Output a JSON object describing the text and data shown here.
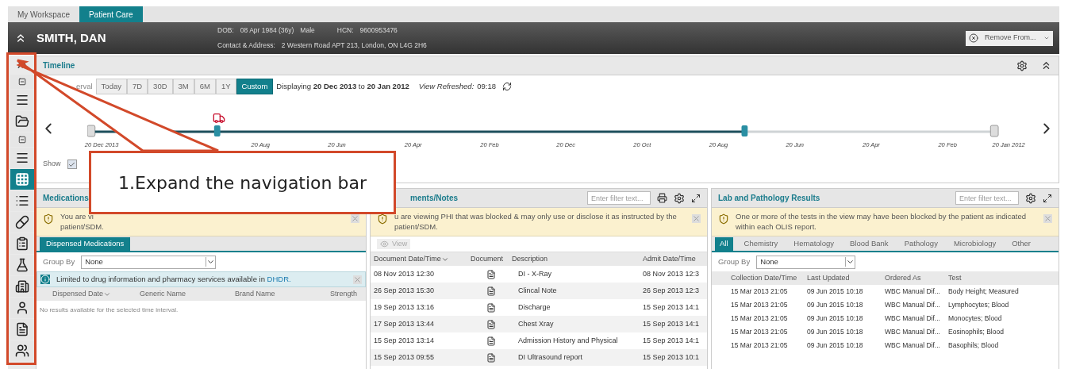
{
  "top_tabs": [
    {
      "label": "My Workspace",
      "selected": false
    },
    {
      "label": "Patient Care",
      "selected": true
    }
  ],
  "patient": {
    "name": "SMITH, DAN",
    "dob_label": "DOB:",
    "dob": "08 Apr 1984 (36y)",
    "sex": "Male",
    "hcn_label": "HCN:",
    "hcn": "9600953476",
    "address_label": "Contact & Address:",
    "address": "2 Western Road APT 213, London, ON L4G 2H6",
    "remove_button": "Remove From..."
  },
  "nav": [
    {
      "kind": "collapse",
      "selected": false
    },
    {
      "kind": "menu",
      "selected": false
    },
    {
      "kind": "folder",
      "selected": false
    },
    {
      "kind": "collapse",
      "selected": false
    },
    {
      "kind": "menu",
      "selected": false
    },
    {
      "kind": "grid",
      "selected": true
    },
    {
      "kind": "list",
      "selected": false
    },
    {
      "kind": "pills",
      "selected": false
    },
    {
      "kind": "clipboard",
      "selected": false
    },
    {
      "kind": "flask",
      "selected": false
    },
    {
      "kind": "building",
      "selected": false
    },
    {
      "kind": "person",
      "selected": false
    },
    {
      "kind": "document",
      "selected": false
    },
    {
      "kind": "group",
      "selected": false
    }
  ],
  "timeline": {
    "title": "Timeline",
    "interval_label": "erval",
    "intervals": [
      {
        "label": "Today",
        "selected": false
      },
      {
        "label": "7D",
        "selected": false
      },
      {
        "label": "30D",
        "selected": false
      },
      {
        "label": "3M",
        "selected": false
      },
      {
        "label": "6M",
        "selected": false
      },
      {
        "label": "1Y",
        "selected": false
      },
      {
        "label": "Custom",
        "selected": true
      }
    ],
    "displaying": "Displaying **20 Dec 2013** to **20 Jan 2012**",
    "refreshed_label": "View Refreshed:",
    "refreshed": "09:18",
    "ticks": [
      "20 Dec 2013",
      "20 Aug",
      "20 Jun",
      "20 Apr",
      "20 Feb",
      "20 Dec",
      "20 Oct",
      "20 Aug",
      "20 Jun",
      "20 Apr",
      "20 Feb",
      "20 Jan 2012"
    ],
    "show_label": "Show",
    "show_checked": true
  },
  "callout": {
    "text": "1.Expand the navigation bar"
  },
  "medications": {
    "title": "Medications",
    "warning": [
      "You are vi",
      "patient/SDM."
    ],
    "tab": "Dispensed Medications",
    "group_by_label": "Group By",
    "group_by": "None",
    "info": "Limited to drug information and pharmacy services available in",
    "info_link": "DHDR.",
    "columns": [
      "Dispensed Date",
      "Generic Name",
      "Brand Name",
      "Strength"
    ],
    "empty": "No results available for the selected time interval."
  },
  "documents": {
    "title": "ments/Notes",
    "filter_placeholder": "Enter filter text...",
    "warning": "u are viewing PHI that was blocked & may only use or disclose it as instructed by the patient/SDM.",
    "view_button": "View",
    "columns": [
      "Document Date/Time",
      "Document",
      "Description",
      "Admit Date/Time"
    ],
    "rows": [
      {
        "date": "08 Nov 2013 12:30",
        "description": "DI - X-Ray",
        "admit": "08 Nov 2013 12:3",
        "selected": false
      },
      {
        "date": "26 Sep 2013 15:30",
        "description": "Clincal Note",
        "admit": "26 Sep 2013 12:3",
        "selected": false
      },
      {
        "date": "19 Sep 2013 13:16",
        "description": "Discharge",
        "admit": "15 Sep 2013 14:1",
        "selected": false
      },
      {
        "date": "17 Sep 2013 13:44",
        "description": "Chest Xray",
        "admit": "15 Sep 2013 14:1",
        "selected": false
      },
      {
        "date": "15 Sep 2013 13:14",
        "description": "Admission History and Physical",
        "admit": "15 Sep 2013 14:1",
        "selected": false
      },
      {
        "date": "15 Sep 2013 09:55",
        "description": "DI Ultrasound report",
        "admit": "15 Sep 2013 10:1",
        "selected": false
      }
    ]
  },
  "labs": {
    "title": "Lab and Pathology Results",
    "filter_placeholder": "Enter filter text...",
    "warning": "One or more of the tests in the view may have been blocked by the patient as indicated within each OLIS report.",
    "tabs": [
      {
        "label": "All",
        "selected": true
      },
      {
        "label": "Chemistry",
        "selected": false
      },
      {
        "label": "Hematology",
        "selected": false
      },
      {
        "label": "Blood Bank",
        "selected": false
      },
      {
        "label": "Pathology",
        "selected": false
      },
      {
        "label": "Microbiology",
        "selected": false
      },
      {
        "label": "Other",
        "selected": false
      }
    ],
    "group_by_label": "Group By",
    "group_by": "None",
    "columns": [
      "Collection Date/Time",
      "Last Updated",
      "Ordered As",
      "Test"
    ],
    "rows": [
      [
        "15 Mar 2013 21:05",
        "09 Jun 2015 10:18",
        "WBC Manual Dif...",
        "Body Height; Measured"
      ],
      [
        "15 Mar 2013 21:05",
        "09 Jun 2015 10:18",
        "WBC Manual Dif...",
        "Lymphocytes; Blood"
      ],
      [
        "15 Mar 2013 21:05",
        "09 Jun 2015 10:18",
        "WBC Manual Dif...",
        "Monocytes; Blood"
      ],
      [
        "15 Mar 2013 21:05",
        "09 Jun 2015 10:18",
        "WBC Manual Dif...",
        "Eosinophils; Blood"
      ],
      [
        "15 Mar 2013 21:05",
        "09 Jun 2015 10:18",
        "WBC Manual Dif...",
        "Basophils; Blood"
      ]
    ]
  }
}
